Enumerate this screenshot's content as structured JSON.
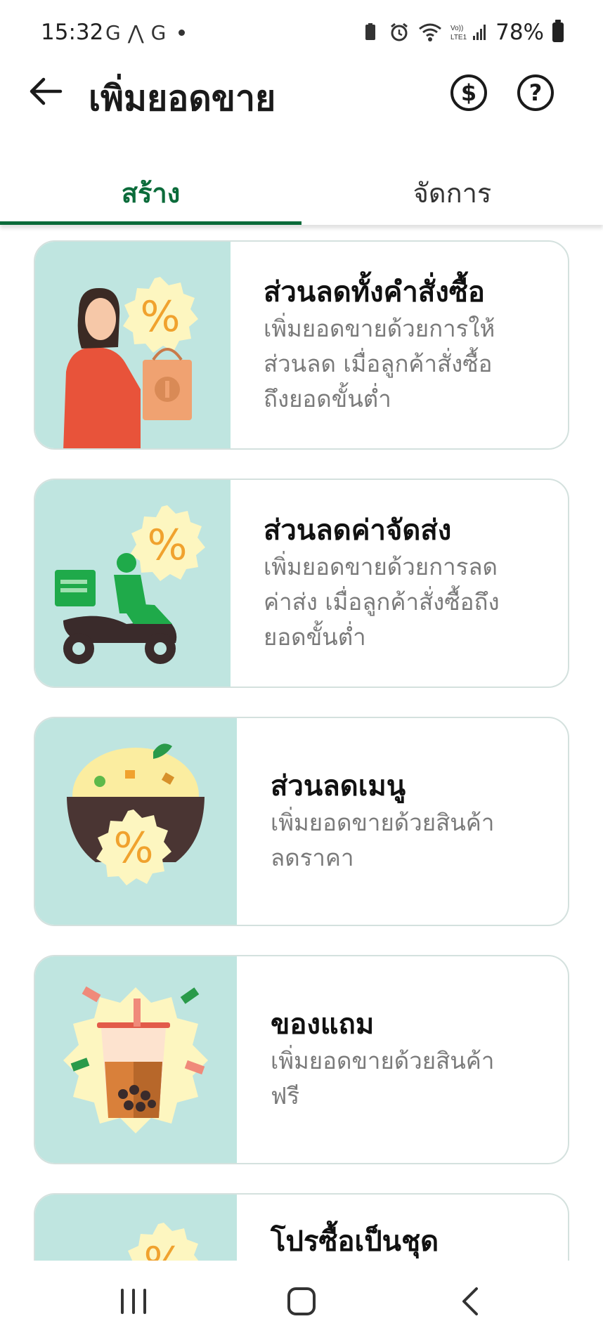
{
  "status": {
    "time": "15:32",
    "left_icons": [
      "G",
      "⋀",
      "G"
    ],
    "battery": "78%"
  },
  "header": {
    "title": "เพิ่มยอดขาย",
    "back_icon": "arrow-left-icon",
    "dollar_icon": "dollar-circle-icon",
    "help_icon": "help-circle-icon"
  },
  "tabs": [
    {
      "label": "สร้าง",
      "active": true
    },
    {
      "label": "จัดการ",
      "active": false
    }
  ],
  "cards": [
    {
      "title": "ส่วนลดทั้งคำสั่งซื้อ",
      "desc": "เพิ่มยอดขายด้วยการให้\nส่วนลด เมื่อลูกค้าสั่งซื้อ\nถึงยอดขั้นต่ำ"
    },
    {
      "title": "ส่วนลดค่าจัดส่ง",
      "desc": "เพิ่มยอดขายด้วยการลด\nค่าส่ง เมื่อลูกค้าสั่งซื้อถึง\nยอดขั้นต่ำ"
    },
    {
      "title": "ส่วนลดเมนู",
      "desc": "เพิ่มยอดขายด้วยสินค้า\nลดราคา"
    },
    {
      "title": "ของแถม",
      "desc": "เพิ่มยอดขายด้วยสินค้า\nฟรี"
    },
    {
      "title": "โปรซื้อเป็นชุด",
      "desc": ""
    }
  ],
  "colors": {
    "accent": "#0b6b3a",
    "art_bg": "#bfe5e0",
    "badge_yellow": "#fdf6c0",
    "percent_orange": "#f0a22e"
  },
  "nav": {
    "recents_icon": "recents-icon",
    "home_icon": "home-icon",
    "back_icon": "back-chevron-icon"
  }
}
